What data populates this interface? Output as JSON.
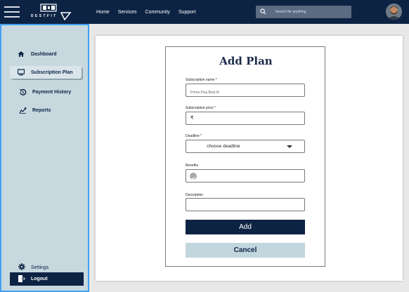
{
  "topbar": {
    "nav": [
      "Home",
      "Services",
      "Community",
      "Support"
    ],
    "search_placeholder": "Search for anything",
    "logo_text": "DESTFIT"
  },
  "sidebar": {
    "items": [
      {
        "label": "Dashboard",
        "icon": "home-icon"
      },
      {
        "label": "Subscription Plan",
        "icon": "monitor-icon",
        "active": true
      },
      {
        "label": "Payment History",
        "icon": "history-icon"
      },
      {
        "label": "Reports",
        "icon": "chart-icon"
      }
    ],
    "settings_label": "Settings",
    "logout_label": "Logout"
  },
  "form": {
    "title": "Add Plan",
    "name_label": "Subscription name *",
    "name_placeholder": "Prime,Plus,Best fit",
    "price_label": "Subscription price *",
    "price_prefix": "₹",
    "deadline_label": "Deadline *",
    "deadline_value": "choose deadline",
    "benefits_label": "Benefits",
    "description_label": "Description",
    "add_label": "Add",
    "cancel_label": "Cancel"
  },
  "colors": {
    "navy": "#0d2344",
    "sidebar_bg": "#c7d8df",
    "sidebar_border": "#3fa0f2",
    "cancel_bg": "#c2d6dd"
  }
}
